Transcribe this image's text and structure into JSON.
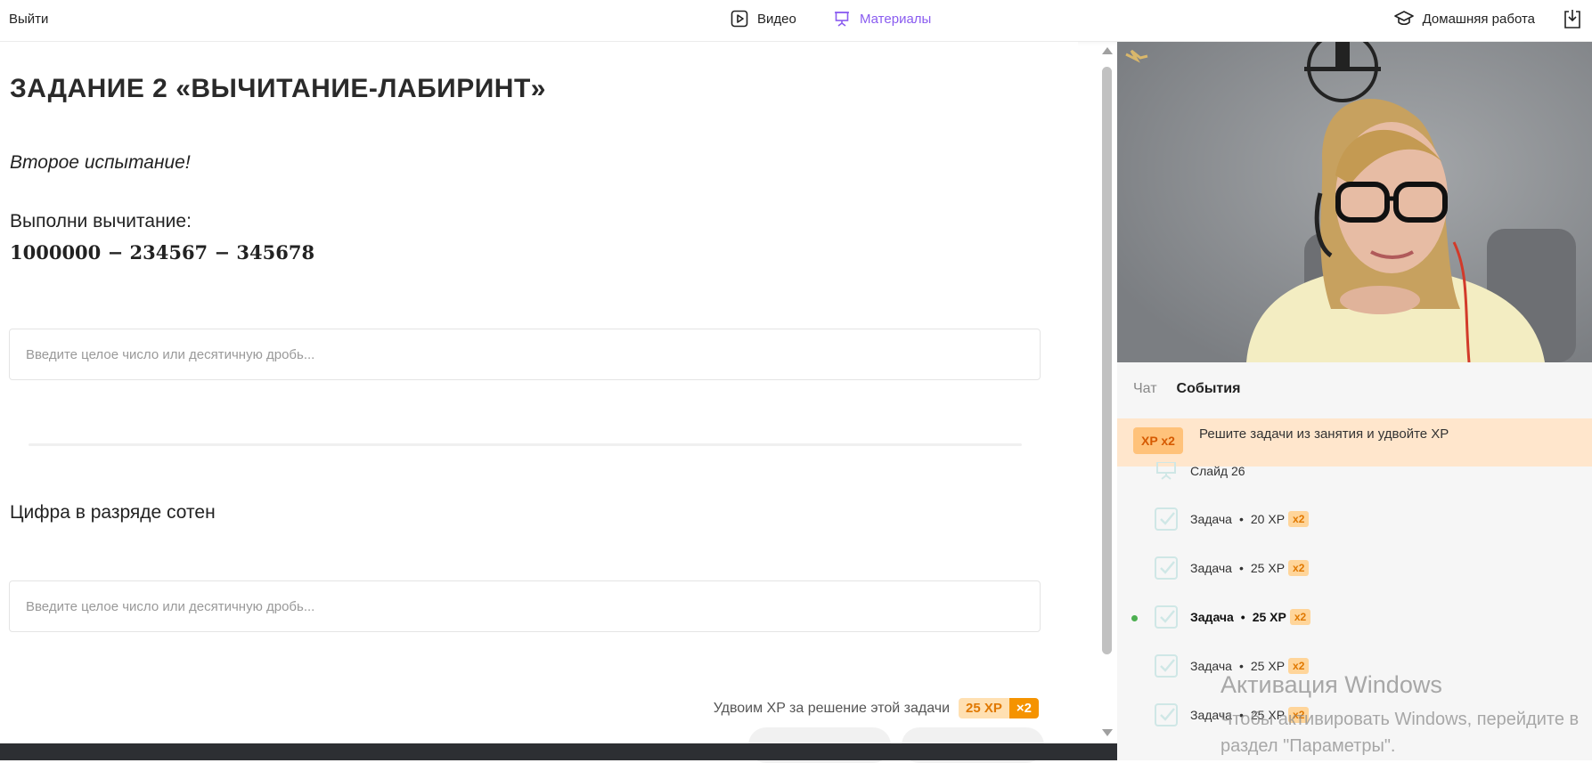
{
  "topbar": {
    "exit_label": "Выйти",
    "tab_video": "Видео",
    "tab_materials": "Материалы",
    "homework": "Домашняя работа"
  },
  "task": {
    "title": "ЗАДАНИЕ 2 «ВЫЧИТАНИЕ-ЛАБИРИНТ»",
    "subtitle": "Второе испытание!",
    "instruction": "Выполни вычитание:",
    "expression": "1000000 − 234567 − 345678",
    "input_placeholder": "Введите целое число или десятичную дробь...",
    "question2": "Цифра в разряде сотен",
    "input2_placeholder": "Введите целое число или десятичную дробь...",
    "xp_note": "Удвоим XP за решение этой задачи",
    "xp_value": "25 XP",
    "xp_mult": "×2"
  },
  "sidebar": {
    "tab_chat": "Чат",
    "tab_events": "События",
    "promo_badge": "XP x2",
    "promo_text": "Решите задачи из занятия и удвойте XP",
    "slide_label": "Слайд 26",
    "events": [
      {
        "label": "Задача",
        "xp": "20 XP",
        "mult": "x2"
      },
      {
        "label": "Задача",
        "xp": "25 XP",
        "mult": "x2"
      },
      {
        "label": "Задача",
        "xp": "25 XP",
        "mult": "x2",
        "active": true
      },
      {
        "label": "Задача",
        "xp": "25 XP",
        "mult": "x2"
      },
      {
        "label": "Задача",
        "xp": "25 XP",
        "mult": "x2"
      }
    ]
  },
  "watermark": {
    "line1": "Активация Windows",
    "line2": "Чтобы активировать Windows, перейдите в",
    "line3": "раздел \"Параметры\"."
  },
  "colors": {
    "accent": "#8a5cf0",
    "xp_orange": "#f59300",
    "promo_bg": "#ffe6cc"
  }
}
